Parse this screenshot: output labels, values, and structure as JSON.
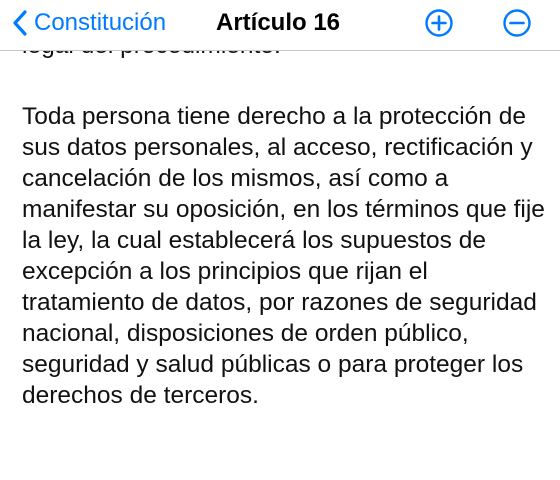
{
  "navbar": {
    "back_label": "Constitución",
    "title": "Artículo 16",
    "back_icon": "chevron-left-icon",
    "zoom_in_icon": "plus-circle-icon",
    "zoom_out_icon": "minus-circle-icon"
  },
  "article": {
    "previous_paragraph_tail": "legal del procedimiento.",
    "paragraph": "Toda persona tiene derecho a la protección de sus datos personales, al acceso, rectificación y cancelación de los mismos, así como a manifestar su oposición, en los términos que fije la ley, la cual establecerá los supuestos de excepción a los principios que rijan el tratamiento de datos, por razones de seguridad nacional, disposiciones de orden público, seguridad y salud públicas o para proteger los derechos de terceros."
  },
  "colors": {
    "accent": "#007aff",
    "text": "#111111",
    "separator": "#c8c7cc",
    "background": "#ffffff"
  }
}
